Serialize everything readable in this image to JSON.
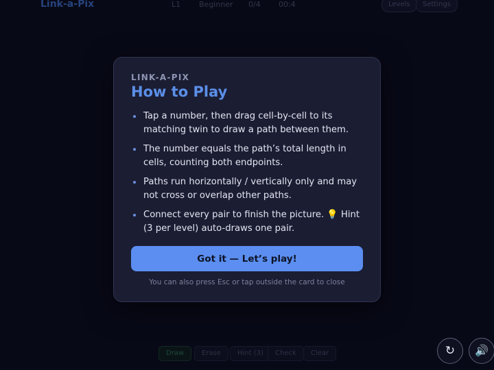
{
  "app": {
    "brand": "Link-a-Pix",
    "level": "L1",
    "difficulty": "Beginner",
    "progress": "0/4",
    "timer": "00:4",
    "levels_label": "Levels",
    "settings_label": "Settings"
  },
  "toolbar": {
    "draw_label": "Draw",
    "erase_label": "Erase",
    "hint_label": "Hint (3)",
    "check_label": "Check",
    "clear_label": "Clear"
  },
  "floating": {
    "restart_icon": "↻",
    "sound_icon": "🔊"
  },
  "modal": {
    "eyebrow": "LINK-A-PIX",
    "title": "How to Play",
    "rules": [
      "Tap a number, then drag cell-by-cell to its matching twin to draw a path between them.",
      "The number equals the path’s total length in cells, counting both endpoints.",
      "Paths run horizontally / vertically only and may not cross or overlap other paths.",
      "Connect every pair to finish the picture. 💡 Hint (3 per level) auto-draws one pair."
    ],
    "cta_label": "Got it — Let’s play!",
    "close_hint": "You can also press Esc or tap outside the card to close"
  },
  "colors": {
    "accent": "#5b8ef0",
    "title": "#5b8fe8",
    "card_bg": "#1b1d33",
    "page_bg": "#0b0c1c"
  }
}
